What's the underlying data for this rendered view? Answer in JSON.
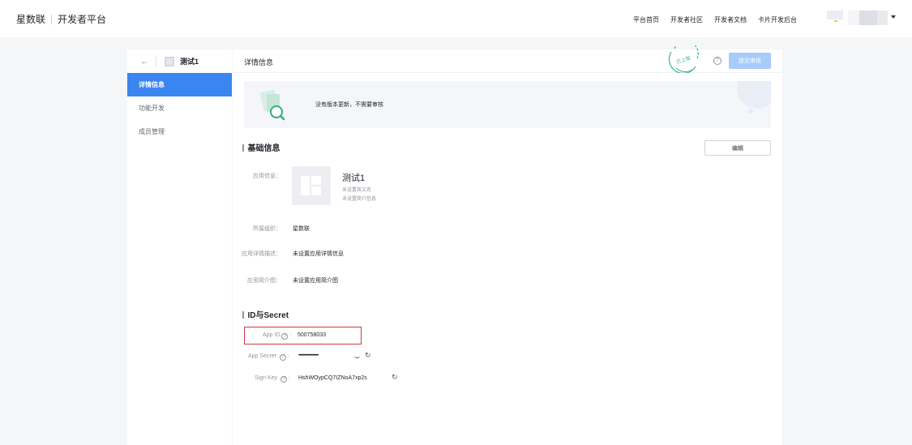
{
  "header": {
    "brand": "星数联",
    "platform": "开发者平台",
    "nav": [
      "平台首页",
      "开发者社区",
      "开发者文档",
      "卡片开发后台"
    ]
  },
  "sidebar": {
    "back_icon": "arrow-left-icon",
    "app_name": "测试1",
    "items": [
      {
        "label": "详情信息",
        "active": true
      },
      {
        "label": "功能开发",
        "active": false
      },
      {
        "label": "成员管理",
        "active": false
      }
    ]
  },
  "main": {
    "title": "详情信息",
    "stamp_text": "已上架",
    "submit_label": "提交审核",
    "notice": "没有版本更新，不需要审核",
    "basic": {
      "section_title": "基础信息",
      "edit_label": "编辑",
      "app_info_label": "应用信息：",
      "app_name": "测试1",
      "english_name": "未设置英文名",
      "intro": "未设置简介信息",
      "org_label": "所属组织：",
      "org_value": "星数联",
      "desc_label": "应用详情描述：",
      "desc_value": "未设置应用详情信息",
      "image_label": "应用简介图：",
      "image_value": "未设置应用简介图"
    },
    "secret": {
      "section_title": "ID与Secret",
      "app_id_label": "App ID",
      "app_id": "500758033",
      "secret_label": "App Secret",
      "secret_value": "••••••••••••••••••••••",
      "sign_key_label": "Sign Key",
      "sign_key": "HshWOypCQ7IZNoA7xp2s"
    }
  },
  "colors": {
    "accent": "#3a86f0",
    "submit_disabled": "#a7cbfb",
    "highlight_box": "#d9363e",
    "stamp": "#39b57a"
  }
}
